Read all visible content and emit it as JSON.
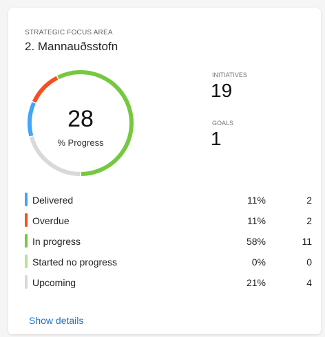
{
  "card": {
    "eyebrow": "STRATEGIC FOCUS AREA",
    "title": "2. Mannauðsstofn"
  },
  "progress": {
    "value": "28",
    "label": "% Progress"
  },
  "stats": {
    "initiatives_label": "INITIATIVES",
    "initiatives_value": "19",
    "goals_label": "GOALS",
    "goals_value": "1"
  },
  "legend": [
    {
      "name": "Delivered",
      "pct": "11%",
      "count": "2",
      "color": "#42a5f5"
    },
    {
      "name": "Overdue",
      "pct": "11%",
      "count": "2",
      "color": "#f4511e"
    },
    {
      "name": "In progress",
      "pct": "58%",
      "count": "11",
      "color": "#76c93f"
    },
    {
      "name": "Started no progress",
      "pct": "0%",
      "count": "0",
      "color": "#b4e58e"
    },
    {
      "name": "Upcoming",
      "pct": "21%",
      "count": "4",
      "color": "#d9d9d9"
    }
  ],
  "chart_data": {
    "type": "pie",
    "categories": [
      "Delivered",
      "Overdue",
      "In progress",
      "Started no progress",
      "Upcoming"
    ],
    "values": [
      11,
      11,
      58,
      0,
      21
    ],
    "counts": [
      2,
      2,
      11,
      0,
      4
    ],
    "colors": [
      "#42a5f5",
      "#f4511e",
      "#76c93f",
      "#b4e58e",
      "#d9d9d9"
    ]
  },
  "actions": {
    "show_details": "Show details"
  }
}
